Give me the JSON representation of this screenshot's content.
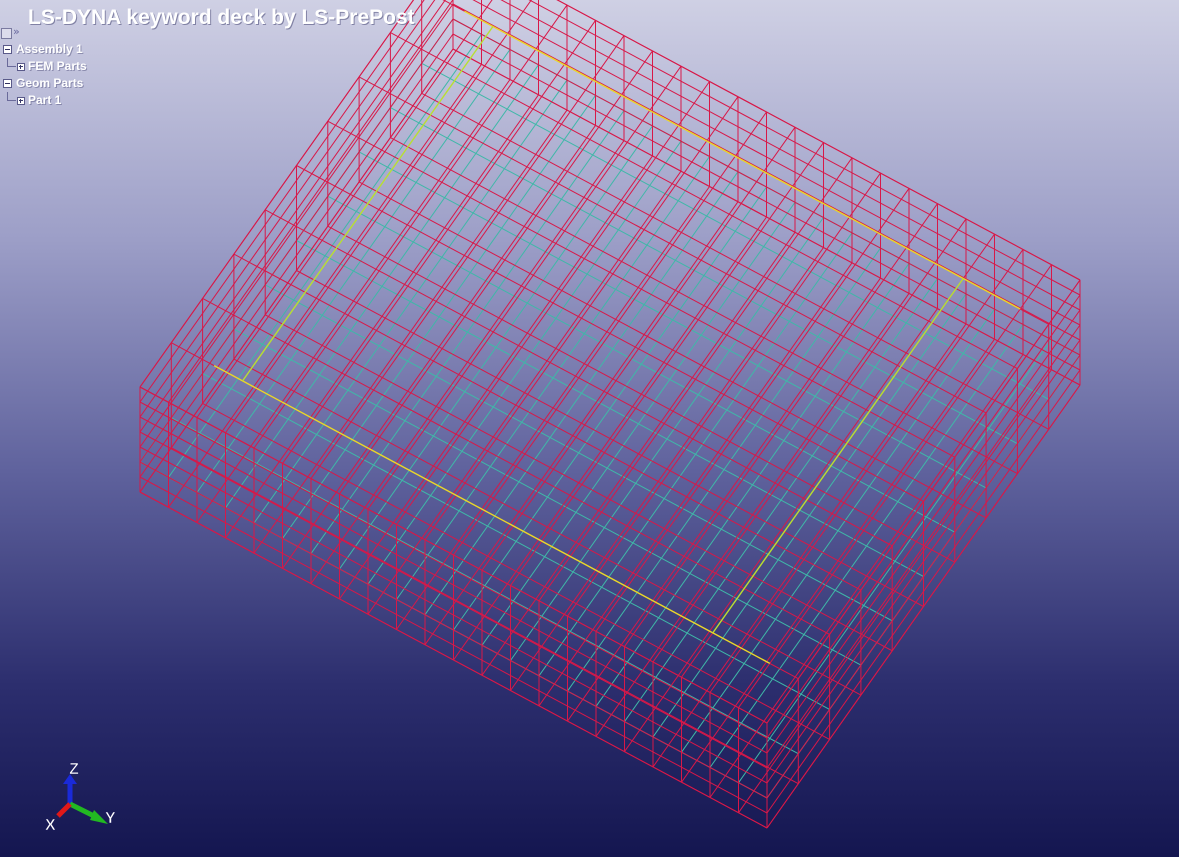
{
  "title": "LS-DYNA keyword deck by LS-PrePost",
  "tree": {
    "items": [
      {
        "label": "Assembly 1"
      },
      {
        "label": "FEM Parts"
      },
      {
        "label": "Geom Parts"
      },
      {
        "label": "Part 1"
      }
    ]
  },
  "axes": {
    "z": "Z",
    "y": "Y",
    "x": "X"
  },
  "colors": {
    "mesh": "#d81848",
    "inner_mesh": "#3fb8a8",
    "edge_yellow": "#e8d82a",
    "edge_green": "#b8e030",
    "axis_z": "#1a2ad8",
    "axis_y": "#22b822",
    "axis_x": "#e01818"
  }
}
